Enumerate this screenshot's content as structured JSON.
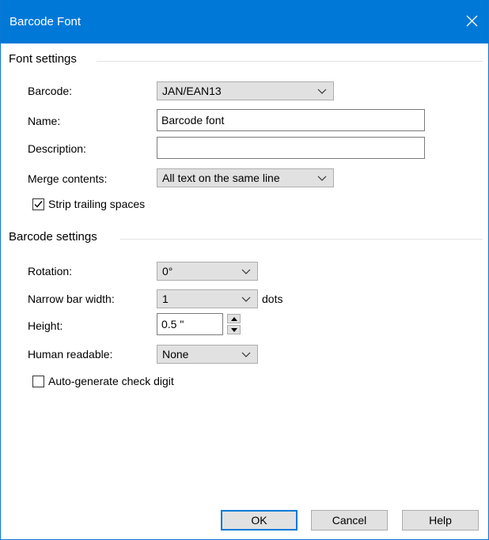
{
  "window": {
    "title": "Barcode Font"
  },
  "font_settings": {
    "heading": "Font settings",
    "barcode": {
      "label": "Barcode:",
      "value": "JAN/EAN13"
    },
    "name": {
      "label": "Name:",
      "value": "Barcode font"
    },
    "description": {
      "label": "Description:",
      "value": ""
    },
    "merge": {
      "label": "Merge contents:",
      "value": "All text on the same line"
    },
    "strip": {
      "label": "Strip trailing spaces",
      "checked": true
    }
  },
  "barcode_settings": {
    "heading": "Barcode settings",
    "rotation": {
      "label": "Rotation:",
      "value": "0°"
    },
    "narrow": {
      "label": "Narrow bar width:",
      "value": "1",
      "unit": "dots"
    },
    "height": {
      "label": "Height:",
      "value": "0.5 \""
    },
    "human": {
      "label": "Human readable:",
      "value": "None"
    },
    "checkdigit": {
      "label": "Auto-generate check digit",
      "checked": false
    }
  },
  "buttons": {
    "ok": "OK",
    "cancel": "Cancel",
    "help": "Help"
  },
  "colors": {
    "titlebar": "#0078d7",
    "button_face": "#e1e1e1"
  }
}
